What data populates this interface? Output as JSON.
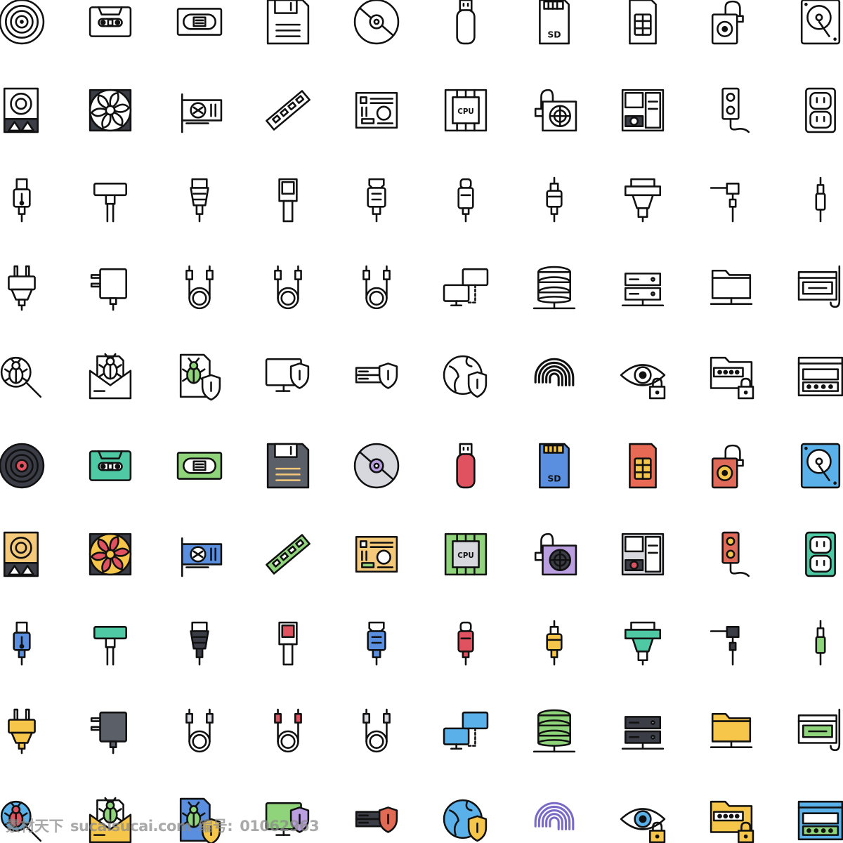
{
  "watermark": {
    "brand": "素材天下",
    "site": "sucaisucai.com",
    "id_label": "编号:",
    "id": "01062963"
  },
  "outline_color": "#ffffff",
  "stroke_color": "#111111",
  "icons": [
    {
      "name": "vinyl-record",
      "main": "#3a3d45",
      "accent": "#e0525f"
    },
    {
      "name": "cassette-tape",
      "main": "#4fc9a4",
      "accent": "#ffffff"
    },
    {
      "name": "vhs-tape",
      "main": "#8fd37a",
      "accent": "#ffffff"
    },
    {
      "name": "floppy-disk",
      "main": "#5a5f68",
      "accent": "#f5c97a"
    },
    {
      "name": "cd-disc",
      "main": "#d6d8de",
      "accent": "#b99ee0"
    },
    {
      "name": "usb-flash-drive",
      "main": "#e0525f",
      "accent": "#ffffff"
    },
    {
      "name": "sd-card",
      "main": "#5a8fe0",
      "accent": "#f5c64a"
    },
    {
      "name": "sim-card",
      "main": "#e96a54",
      "accent": "#f5c64a"
    },
    {
      "name": "portable-hard-drive",
      "main": "#e06a5a",
      "accent": "#f5c64a"
    },
    {
      "name": "hard-disk",
      "main": "#5ab0e8",
      "accent": "#ffffff"
    },
    {
      "name": "speaker-drive",
      "main": "#f5c97a",
      "accent": "#3a3d45"
    },
    {
      "name": "cooling-fan",
      "main": "#e0525f",
      "accent": "#f5c64a"
    },
    {
      "name": "graphics-card",
      "main": "#5a8fe0",
      "accent": "#ffffff"
    },
    {
      "name": "ram-memory",
      "main": "#8fd37a",
      "accent": "#ffffff"
    },
    {
      "name": "motherboard",
      "main": "#f5c97a",
      "accent": "#8fd37a"
    },
    {
      "name": "cpu-chip",
      "main": "#8fd37a",
      "accent": "#d6d8de"
    },
    {
      "name": "power-supply",
      "main": "#b99ee0",
      "accent": "#3a3d45"
    },
    {
      "name": "computer-internals",
      "main": "#d6d8de",
      "accent": "#e0525f"
    },
    {
      "name": "power-strip",
      "main": "#e06a5a",
      "accent": "#f5c64a"
    },
    {
      "name": "wall-outlet",
      "main": "#4fc9a4",
      "accent": "#ffffff"
    },
    {
      "name": "usb-cable",
      "main": "#5a8fe0",
      "accent": "#ffffff"
    },
    {
      "name": "dock-connector",
      "main": "#4fc9a4",
      "accent": "#ffffff"
    },
    {
      "name": "ethernet-connector",
      "main": "#3a3d45",
      "accent": "#ffffff"
    },
    {
      "name": "phone-connector",
      "main": "#e0525f",
      "accent": "#ffffff"
    },
    {
      "name": "hdmi-cable",
      "main": "#5a8fe0",
      "accent": "#ffffff"
    },
    {
      "name": "usb-c-cable",
      "main": "#e0525f",
      "accent": "#ffffff"
    },
    {
      "name": "rca-cable",
      "main": "#f5c64a",
      "accent": "#ffffff"
    },
    {
      "name": "vga-cable",
      "main": "#4fc9a4",
      "accent": "#ffffff"
    },
    {
      "name": "audio-jack-angled",
      "main": "#3a3d45",
      "accent": "#ffffff"
    },
    {
      "name": "audio-jack",
      "main": "#8fd37a",
      "accent": "#ffffff"
    },
    {
      "name": "power-plug",
      "main": "#f5c64a",
      "accent": "#ffffff"
    },
    {
      "name": "power-adapter",
      "main": "#5a5f68",
      "accent": "#ffffff"
    },
    {
      "name": "power-cable-coil",
      "main": "#d6d8de",
      "accent": "#ffffff"
    },
    {
      "name": "ethernet-cable-coil",
      "main": "#e0525f",
      "accent": "#ffffff"
    },
    {
      "name": "usb-cable-coil",
      "main": "#d6d8de",
      "accent": "#ffffff"
    },
    {
      "name": "network-computers",
      "main": "#5ab0e8",
      "accent": "#ffffff"
    },
    {
      "name": "database-network",
      "main": "#8fd37a",
      "accent": "#ffffff"
    },
    {
      "name": "server-network",
      "main": "#3a3d45",
      "accent": "#ffffff"
    },
    {
      "name": "folder-network",
      "main": "#f5c64a",
      "accent": "#ffffff"
    },
    {
      "name": "phishing-window",
      "main": "#8fd37a",
      "accent": "#f5c64a"
    },
    {
      "name": "bug-search",
      "main": "#e0525f",
      "accent": "#5ab0e8"
    },
    {
      "name": "email-bug",
      "main": "#f5c64a",
      "accent": "#8fd37a"
    },
    {
      "name": "file-bug-shield",
      "main": "#5a8fe0",
      "accent": "#f5c64a"
    },
    {
      "name": "monitor-shield",
      "main": "#8fd37a",
      "accent": "#b99ee0"
    },
    {
      "name": "server-shield",
      "main": "#3a3d45",
      "accent": "#e06a54"
    },
    {
      "name": "globe-shield",
      "main": "#5ab0e8",
      "accent": "#f5c64a"
    },
    {
      "name": "fingerprint",
      "main": "#7a6ac8",
      "accent": "#ffffff"
    },
    {
      "name": "eye-lock",
      "main": "#5ab0e8",
      "accent": "#f5c64a"
    },
    {
      "name": "folder-password",
      "main": "#f5c64a",
      "accent": "#f5c64a"
    },
    {
      "name": "password-window",
      "main": "#5ab0e8",
      "accent": "#8fd37a"
    }
  ]
}
